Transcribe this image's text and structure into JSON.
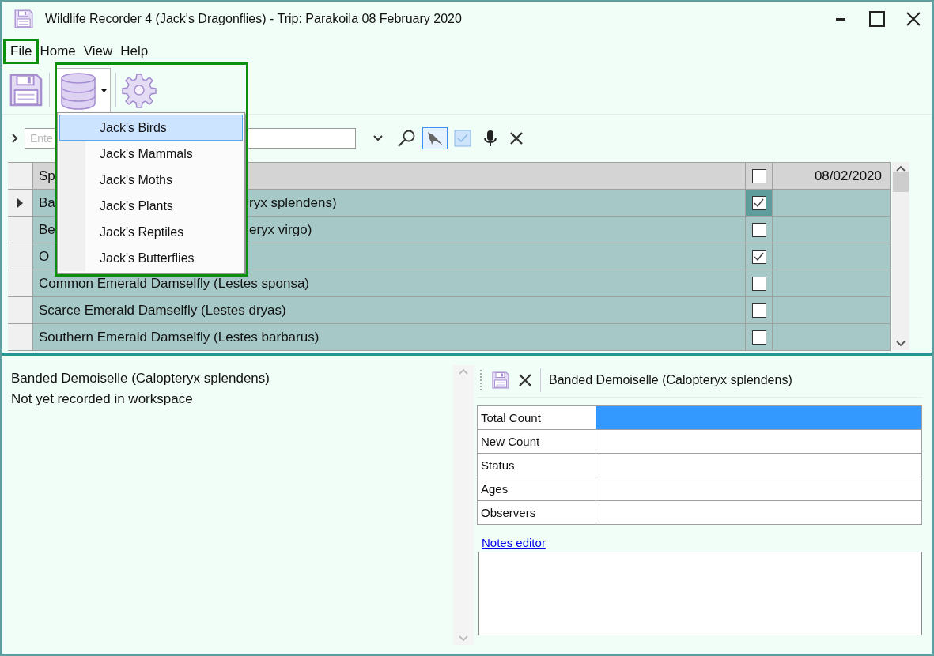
{
  "window": {
    "title": "Wildlife Recorder 4 (Jack's Dragonflies) - Trip: Parakoila 08 February 2020"
  },
  "menu": [
    {
      "label": "File",
      "highlighted": true
    },
    {
      "label": "Home",
      "highlighted": false
    },
    {
      "label": "View",
      "highlighted": false
    },
    {
      "label": "Help",
      "highlighted": false
    }
  ],
  "database_menu": {
    "open": true,
    "highlighted": true,
    "items": [
      {
        "label": "Jack's Birds",
        "selected": true
      },
      {
        "label": "Jack's Mammals",
        "selected": false
      },
      {
        "label": "Jack's Moths",
        "selected": false
      },
      {
        "label": "Jack's Plants",
        "selected": false
      },
      {
        "label": "Jack's Reptiles",
        "selected": false
      },
      {
        "label": "Jack's Butterflies",
        "selected": false
      }
    ]
  },
  "search": {
    "placeholder": "Ente",
    "bird_filter_on": true
  },
  "grid": {
    "columns": [
      "Sp",
      "08/02/2020"
    ],
    "header_checked": false,
    "rows": [
      {
        "name": "Ba",
        "name_tail": "ryx splendens)",
        "checked": true,
        "current": true
      },
      {
        "name": "Be",
        "name_tail": "eryx virgo)",
        "checked": false,
        "current": false
      },
      {
        "name": "O",
        "checked": true,
        "current": false
      },
      {
        "name": "Common Emerald Damselfly (Lestes sponsa)",
        "checked": false,
        "current": false
      },
      {
        "name": "Scarce Emerald Damselfly (Lestes dryas)",
        "checked": false,
        "current": false
      },
      {
        "name": "Southern Emerald Damselfly (Lestes barbarus)",
        "checked": false,
        "current": false
      }
    ]
  },
  "details": {
    "lines": [
      "Banded Demoiselle (Calopteryx splendens)",
      "Not yet recorded in workspace"
    ]
  },
  "record": {
    "title": "Banded Demoiselle (Calopteryx splendens)",
    "fields": [
      {
        "label": "Total Count",
        "selected": true
      },
      {
        "label": "New Count",
        "selected": false
      },
      {
        "label": "Status",
        "selected": false
      },
      {
        "label": "Ages",
        "selected": false
      },
      {
        "label": "Observers",
        "selected": false
      }
    ],
    "notes_link": "Notes editor"
  }
}
